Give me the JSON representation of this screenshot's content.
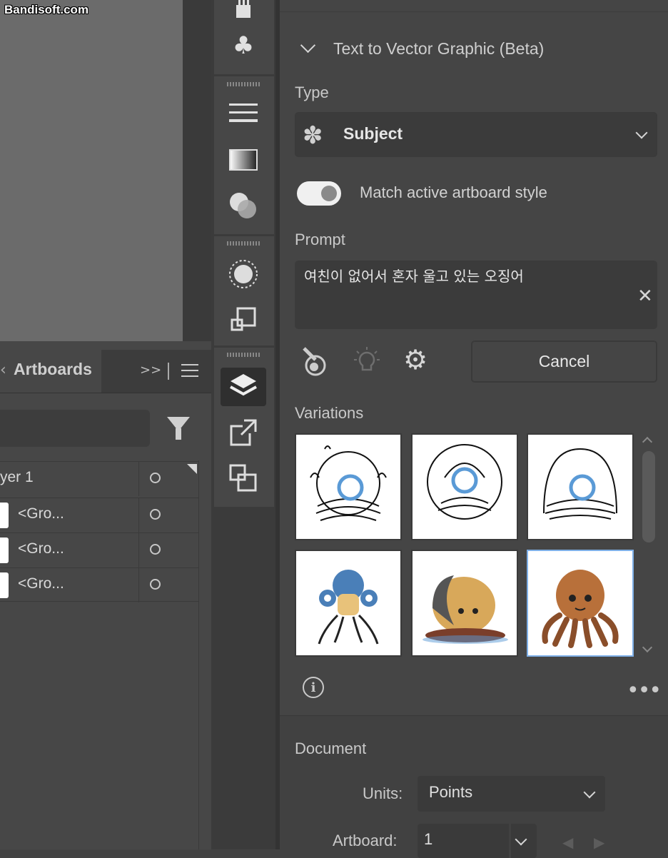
{
  "watermark": "Bandisoft.com",
  "layers_panel": {
    "tab_label": "Artboards",
    "layer_name": "yer 1",
    "rows": [
      {
        "label": "<Gro..."
      },
      {
        "label": "<Gro..."
      },
      {
        "label": "<Gro..."
      }
    ]
  },
  "toolbar": {
    "icons": [
      "brush-icon",
      "symbols-icon",
      "stroke-icon",
      "gradient-icon",
      "transparency-icon",
      "appearance-icon",
      "transform-icon",
      "layers-icon",
      "export-icon",
      "artboards-icon"
    ]
  },
  "properties": {
    "section_title": "Text to Vector Graphic (Beta)",
    "type_label": "Type",
    "type_value": "Subject",
    "toggle_label": "Match active artboard style",
    "toggle_on": true,
    "prompt_label": "Prompt",
    "prompt_text": "여친이 없어서 혼자 울고 있는 오징어",
    "cancel_label": "Cancel",
    "variations_label": "Variations",
    "variations": [
      {
        "style": "line-art"
      },
      {
        "style": "line-art"
      },
      {
        "style": "line-art"
      },
      {
        "style": "blue-octopus"
      },
      {
        "style": "tan-octopus"
      },
      {
        "style": "brown-octopus",
        "selected": true
      }
    ]
  },
  "document": {
    "title": "Document",
    "units_label": "Units:",
    "units_value": "Points",
    "artboard_label": "Artboard:",
    "artboard_value": "1"
  },
  "colors": {
    "panel_bg": "#454545",
    "canvas": "#6b6b6b",
    "selection": "#7fb0e8",
    "loading_ring": "#5a9ad6"
  }
}
